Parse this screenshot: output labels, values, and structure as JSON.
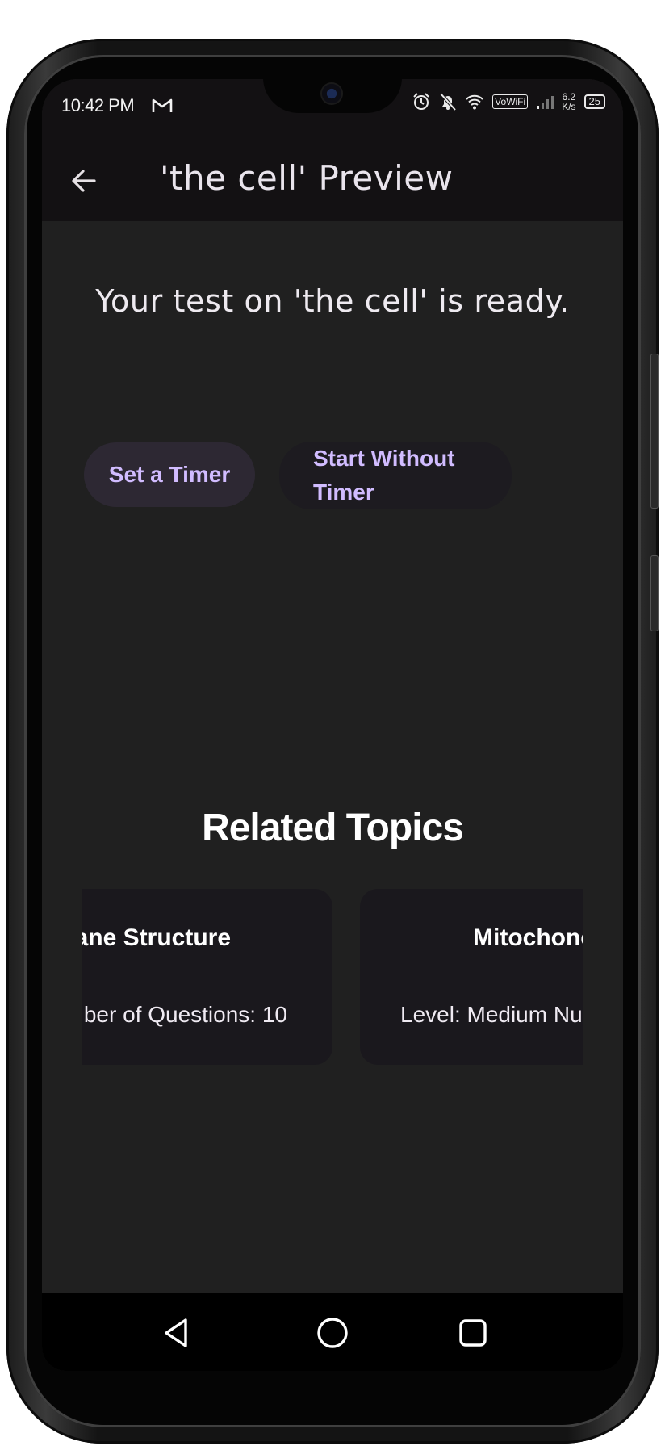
{
  "status_bar": {
    "time": "10:42 PM",
    "network_speed_value": "6.2",
    "network_speed_unit": "K/s",
    "battery": "25",
    "vowifi": "VoWiFi",
    "icons": [
      "gmail-icon",
      "alarm-icon",
      "mute-bell-icon",
      "wifi-icon",
      "vowifi-icon",
      "signal-icon",
      "battery-icon"
    ]
  },
  "app_bar": {
    "title": "'the cell' Preview",
    "back_icon": "arrow-left-icon"
  },
  "main": {
    "ready_text": "Your test on 'the cell' is ready.",
    "set_timer_label": "Set a Timer",
    "start_without_timer_label": "Start Without Timer"
  },
  "related": {
    "heading": "Related Topics",
    "cards": [
      {
        "title": "ane Structure",
        "meta": "ıber of Questions: 10"
      },
      {
        "title": "Mitochonc",
        "meta": "Level: Medium   Nu"
      }
    ]
  },
  "nav": {
    "back_icon": "triangle-back-icon",
    "home_icon": "circle-home-icon",
    "recents_icon": "square-recents-icon"
  },
  "colors": {
    "background": "#202020",
    "app_bar": "#131113",
    "accent_text": "#d1bcff",
    "tonal_button": "#2d2833",
    "card": "#1a181d"
  }
}
